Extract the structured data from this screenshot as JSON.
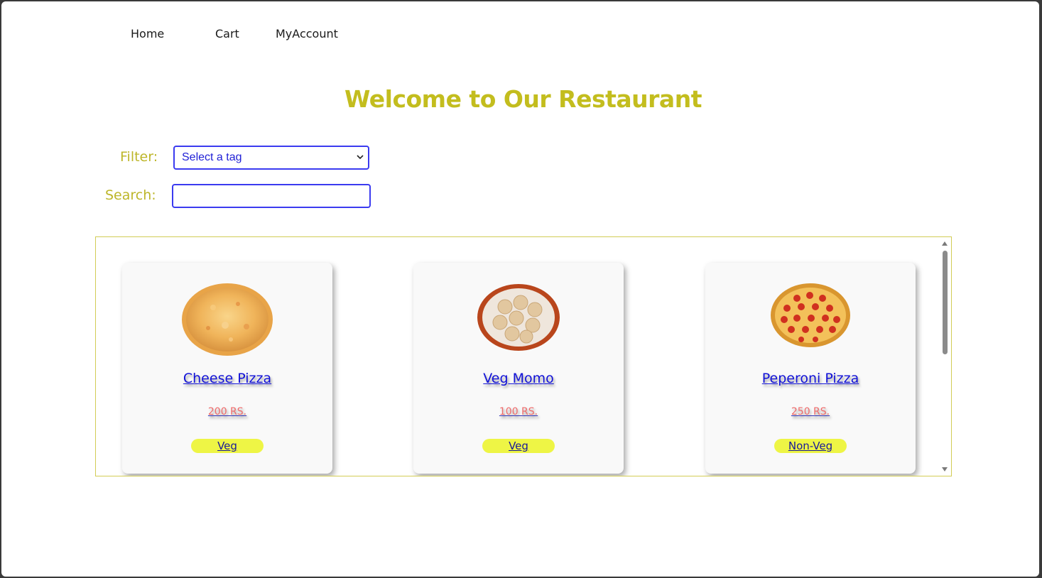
{
  "nav": {
    "home": "Home",
    "cart": "Cart",
    "account": "MyAccount"
  },
  "page": {
    "title": "Welcome to Our Restaurant"
  },
  "filters": {
    "filter_label": "Filter:",
    "select_value": "Select a tag",
    "search_label": "Search:",
    "search_value": ""
  },
  "colors": {
    "title": "#c3bd1e",
    "label": "#bdb62a",
    "link": "#1212d8",
    "price": "#ef6b6b",
    "tag_bg": "#eef545",
    "input_border": "#3b3bf0"
  },
  "menu": {
    "items": [
      {
        "name": "Cheese Pizza",
        "price": "200 RS.",
        "tag": "Veg",
        "image": "cheese-pizza-image"
      },
      {
        "name": "Veg Momo",
        "price": "100 RS.",
        "tag": "Veg",
        "image": "veg-momo-image"
      },
      {
        "name": "Peperoni Pizza",
        "price": "250 RS.",
        "tag": "Non-Veg",
        "image": "pepperoni-pizza-image"
      }
    ]
  }
}
